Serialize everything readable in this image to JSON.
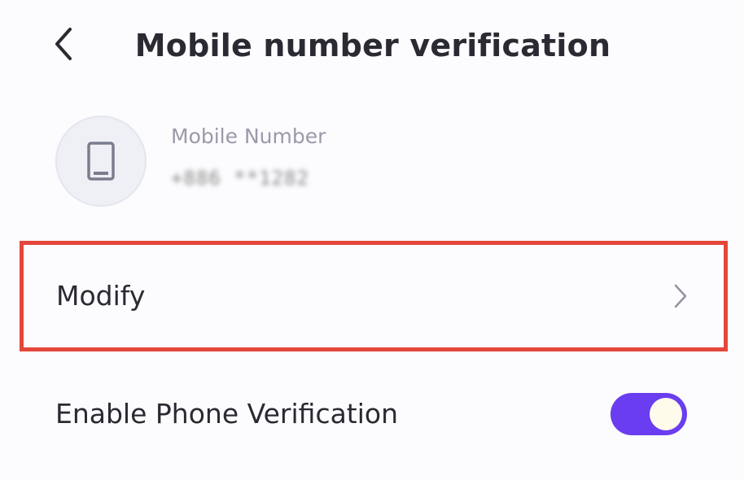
{
  "header": {
    "title": "Mobile number verification",
    "back_icon": "chevron-left-icon"
  },
  "account": {
    "icon": "mobile-phone-icon",
    "label": "Mobile Number",
    "value": "+886 **1282"
  },
  "rows": {
    "modify_label": "Modify",
    "modify_icon": "chevron-right-icon",
    "verification_label": "Enable Phone Verification",
    "verification_enabled": true
  },
  "colors": {
    "highlight": "#e4463c",
    "toggle_on": "#6a3df0",
    "text": "#2a2a33",
    "muted": "#9a9aaa"
  }
}
